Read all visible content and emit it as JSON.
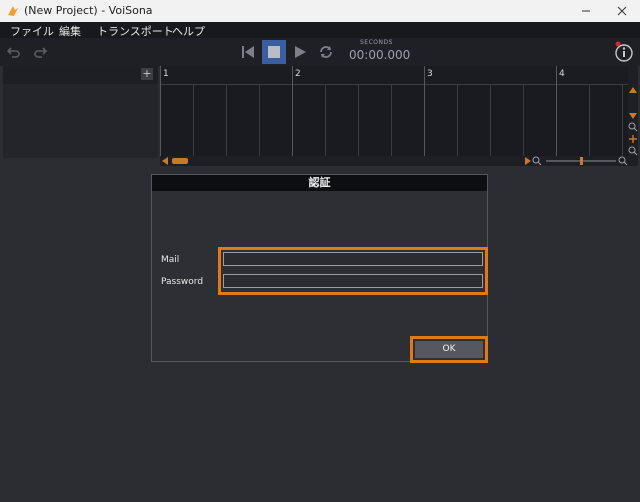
{
  "window": {
    "title": "(New Project) - VoiSona",
    "controls": [
      "minimize",
      "maximize",
      "close"
    ]
  },
  "menu": {
    "items": [
      "ファイル",
      "編集",
      "トランスポート",
      "ヘルプ"
    ]
  },
  "toolbar": {
    "seconds_label": "SECONDS",
    "timecode": "00:00.000"
  },
  "timeline": {
    "bars": [
      "1",
      "2",
      "3",
      "4"
    ],
    "add_track_label": "+"
  },
  "dialog": {
    "title": "認証",
    "mail_label": "Mail",
    "password_label": "Password",
    "mail_value": "",
    "password_value": "",
    "ok_label": "OK"
  },
  "colors": {
    "highlight": "#e07a12",
    "accent": "#c77a2a"
  }
}
